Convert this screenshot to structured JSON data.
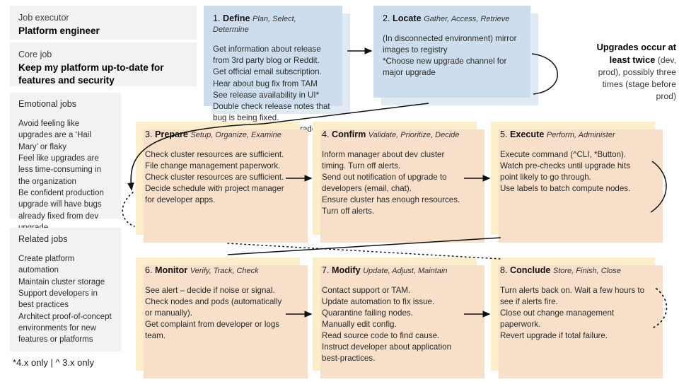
{
  "left_column": {
    "executor": {
      "kicker": "Job executor",
      "headline": "Platform engineer"
    },
    "core_job": {
      "kicker": "Core job",
      "headline": "Keep my platform  up-to-date for features and security"
    },
    "emotional_jobs": {
      "title": "Emotional jobs",
      "body": "Avoid feeling like upgrades are a ‘Hail Mary’ or flaky\nFeel like upgrades are less time-consuming in the organization\nBe confident production upgrade will have bugs already fixed from dev upgrade"
    },
    "related_jobs": {
      "title": "Related jobs",
      "body": "Create platform automation\nMaintain cluster storage\nSupport developers in best practices\nArchitect proof-of-concept environments for new features or platforms"
    },
    "footnote": "*4.x only | ^ 3.x only"
  },
  "callout": {
    "strong": "Upgrades occur at least twice",
    "rest": "(dev, prod), possibly three times (stage before prod)"
  },
  "steps": [
    {
      "num": "1.",
      "word": "Define",
      "verbs": "Plan, Select, Determine",
      "body": "Get information about release from 3rd party blog or Reddit.\nGet official email subscription.\nHear about bug fix from TAM\nSee release availability in UI*\nDouble check release notes that bug is being fixed.\nDetermine timing of upgrade schedule."
    },
    {
      "num": "2.",
      "word": "Locate",
      "verbs": "Gather, Access, Retrieve",
      "body": "(In disconnected environment) mirror images to registry\n*Choose new upgrade channel for major upgrade"
    },
    {
      "num": "3.",
      "word": "Prepare",
      "verbs": "Setup, Organize, Examine",
      "body": "Check cluster resources are sufficient.\nFile change management paperwork.\nCheck cluster resources are sufficient.\nDecide schedule with project manager for developer apps."
    },
    {
      "num": "4.",
      "word": "Confirm",
      "verbs": "Validate, Prioritize, Decide",
      "body": "Inform manager about dev cluster timing. Turn off alerts.\nSend out notification of upgrade to developers (email, chat).\nEnsure cluster has enough resources.\nTurn off alerts."
    },
    {
      "num": "5.",
      "word": "Execute",
      "verbs": "Perform, Administer",
      "body": "Execute command (^CLI, *Button).\nWatch pre-checks until upgrade hits point likely to go through.\nUse labels to batch compute nodes."
    },
    {
      "num": "6.",
      "word": "Monitor",
      "verbs": "Verify, Track, Check",
      "body": "See alert – decide if noise or signal.\nCheck nodes and pods (automatically or manually).\nGet complaint from developer or logs team."
    },
    {
      "num": "7.",
      "word": "Modify",
      "verbs": "Update, Adjust, Maintain",
      "body": "Contact support or TAM.\nUpdate automation to fix issue.\nQuarantine failing nodes.\nManually edit config.\nRead source code to find cause.\nInstruct developer about application best-practices."
    },
    {
      "num": "8.",
      "word": "Conclude",
      "verbs": "Store, Finish, Close",
      "body": "Turn alerts back on. Wait a few hours to see if alerts fire.\nClose out change management paperwork.\nRevert upgrade if total failure."
    }
  ],
  "colors": {
    "blue_card": "#cdddee",
    "cream_card": "#fdeecb",
    "cream_shadow": "#f7dfca",
    "panel_gray": "#f2f2f2",
    "connector": "#111111"
  }
}
